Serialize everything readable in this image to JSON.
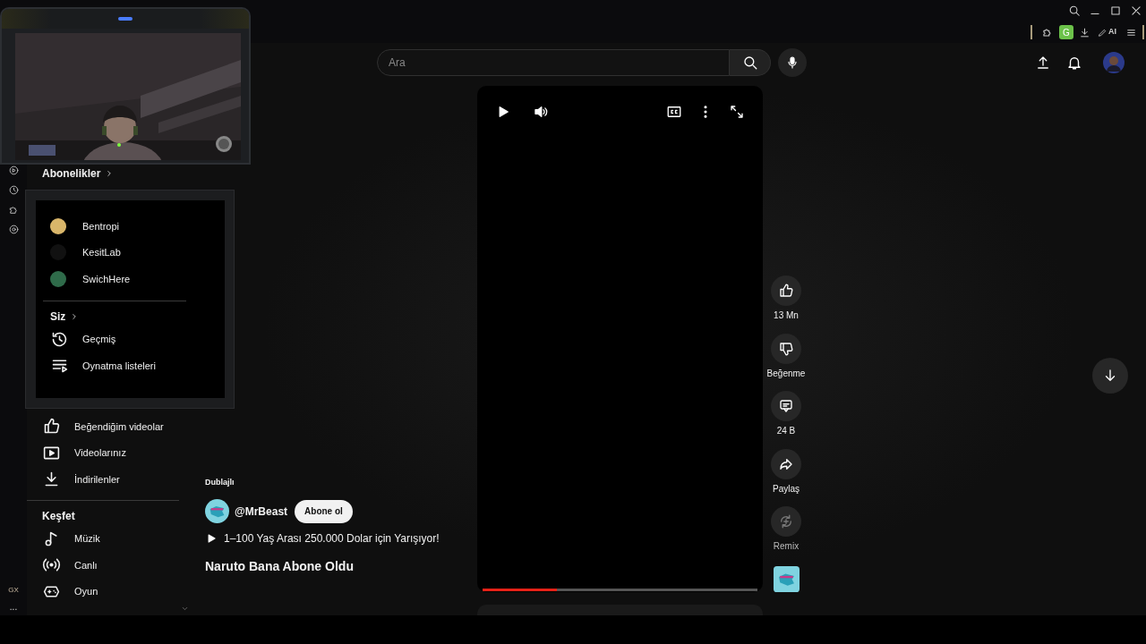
{
  "browser": {
    "extension_badge": "G",
    "ai_label": "AI",
    "sidebar_label": "GX",
    "more_label": "..."
  },
  "search": {
    "placeholder": "Ara"
  },
  "sidebar": {
    "sections": [
      {
        "title": "Abonelikler",
        "items": [
          {
            "kind": "channel",
            "label": "Bentropi",
            "color": "#d9b66a"
          },
          {
            "kind": "channel",
            "label": "KesitLab",
            "color": "#111111"
          },
          {
            "kind": "channel",
            "label": "SwichHere",
            "color": "#2f6b4a"
          }
        ]
      },
      {
        "title": "Siz",
        "items": [
          {
            "kind": "link",
            "label": "Geçmiş"
          },
          {
            "kind": "link",
            "label": "Oynatma listeleri"
          },
          {
            "kind": "link",
            "label": "Beğendiğim videolar"
          },
          {
            "kind": "link",
            "label": "Videolarınız"
          },
          {
            "kind": "link",
            "label": "İndirilenler"
          }
        ]
      },
      {
        "title": "Keşfet",
        "items": [
          {
            "kind": "link",
            "label": "Müzik"
          },
          {
            "kind": "link",
            "label": "Canlı"
          },
          {
            "kind": "link",
            "label": "Oyun"
          }
        ]
      }
    ]
  },
  "short": {
    "badge": "Dublajlı",
    "channel": "@MrBeast",
    "subscribe": "Abone ol",
    "linked_video": "1–100 Yaş Arası 250.000 Dolar için Yarışıyor!",
    "title": "Naruto Bana Abone Oldu",
    "progress": {
      "level": 0.27
    }
  },
  "actions": [
    {
      "label": "13 Mn",
      "disabled": false
    },
    {
      "label": "Beğenme",
      "disabled": false
    },
    {
      "label": "24 B",
      "disabled": false
    },
    {
      "label": "Paylaş",
      "disabled": false
    },
    {
      "label": "Remix",
      "disabled": true
    }
  ]
}
